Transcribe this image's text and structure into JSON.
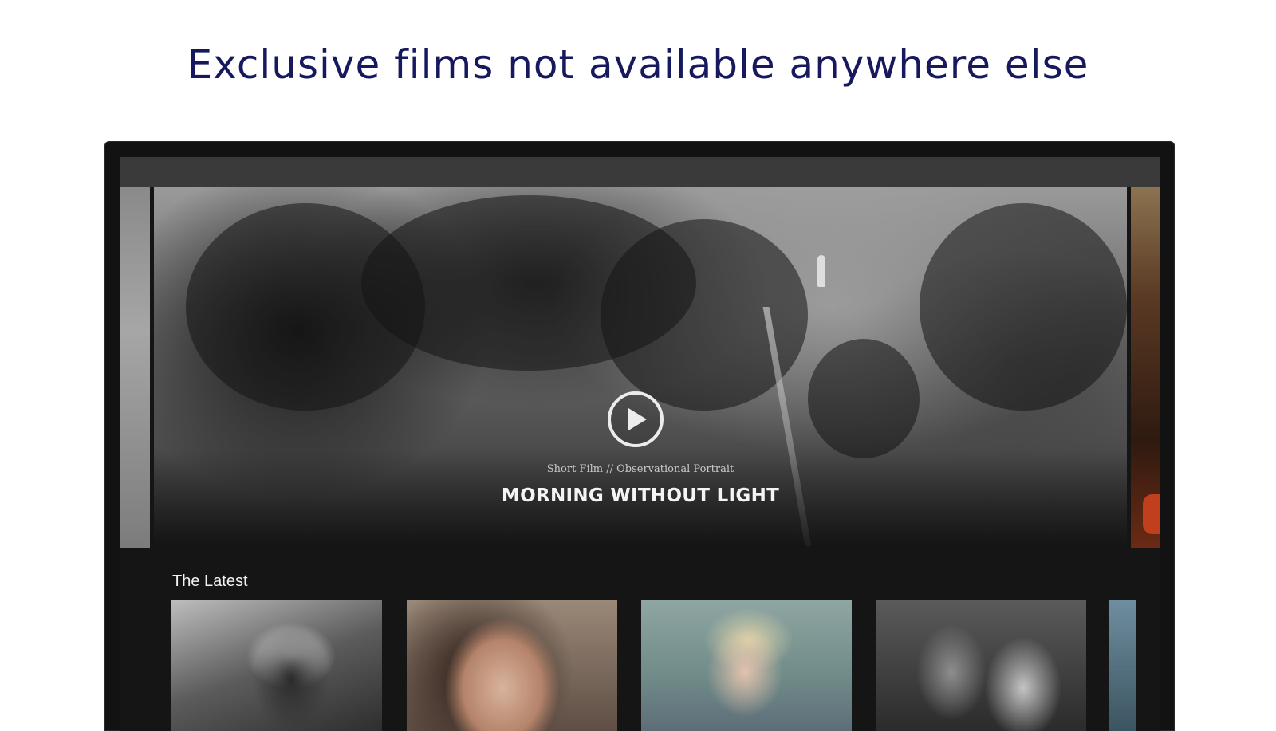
{
  "promo": {
    "headline": "Exclusive films not available anywhere else"
  },
  "hero": {
    "subtitle": "Short Film // Observational Portrait",
    "title": "MORNING WITHOUT LIGHT",
    "play_icon": "play-icon"
  },
  "latest": {
    "heading": "The Latest",
    "items": [
      {
        "thumbnail": "film-thumbnail"
      },
      {
        "thumbnail": "film-thumbnail"
      },
      {
        "thumbnail": "film-thumbnail"
      },
      {
        "thumbnail": "film-thumbnail"
      },
      {
        "thumbnail": "film-thumbnail"
      }
    ]
  },
  "colors": {
    "headline": "#16195e",
    "frame": "#121212",
    "screen_bg": "#151515",
    "top_bar": "#3a3a3a",
    "text_light": "#f4f4f4"
  }
}
